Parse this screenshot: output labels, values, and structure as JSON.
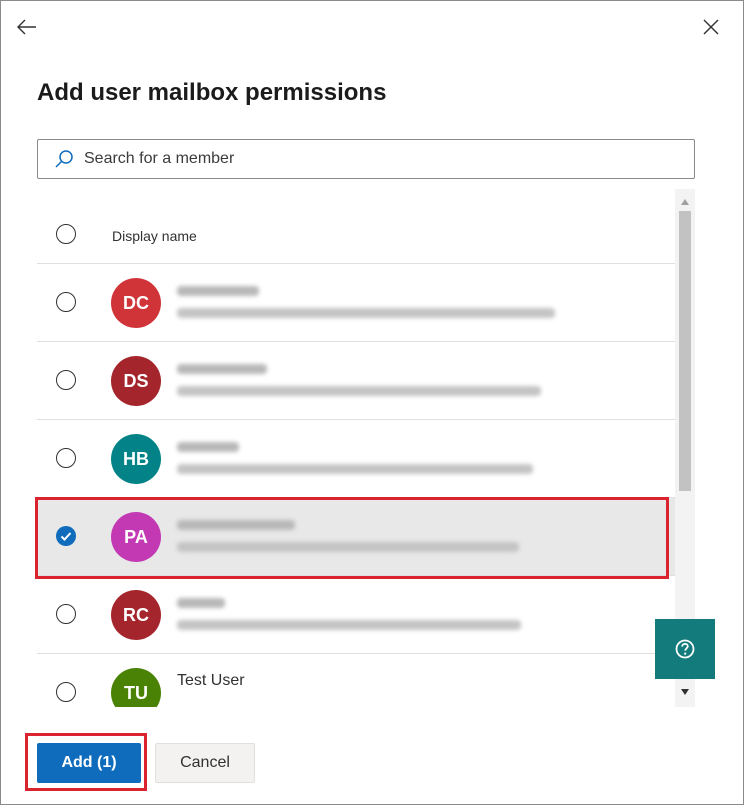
{
  "panel": {
    "title": "Add user mailbox permissions"
  },
  "search": {
    "placeholder": "Search for a member",
    "value": ""
  },
  "table": {
    "header_label": "Display name",
    "header_checked": false,
    "rows": [
      {
        "initials": "DC",
        "avatar_color": "#d13438",
        "name": "",
        "email": "",
        "checked": false,
        "redacted": true
      },
      {
        "initials": "DS",
        "avatar_color": "#a4262c",
        "name": "",
        "email": "",
        "checked": false,
        "redacted": true
      },
      {
        "initials": "HB",
        "avatar_color": "#038387",
        "name": "",
        "email": "",
        "checked": false,
        "redacted": true
      },
      {
        "initials": "PA",
        "avatar_color": "#c239b3",
        "name": "",
        "email": "",
        "checked": true,
        "redacted": true
      },
      {
        "initials": "RC",
        "avatar_color": "#a4262c",
        "name": "",
        "email": "",
        "checked": false,
        "redacted": true
      },
      {
        "initials": "TU",
        "avatar_color": "#498205",
        "name": "Test User",
        "email": "",
        "checked": false,
        "redacted": false
      }
    ]
  },
  "footer": {
    "add_label": "Add (1)",
    "cancel_label": "Cancel"
  },
  "colors": {
    "primary": "#0f6cbd",
    "highlight": "#d9232e",
    "help": "#137b7b"
  },
  "icons": {
    "back": "back-arrow-icon",
    "close": "close-icon",
    "search": "search-icon",
    "help": "help-icon"
  }
}
